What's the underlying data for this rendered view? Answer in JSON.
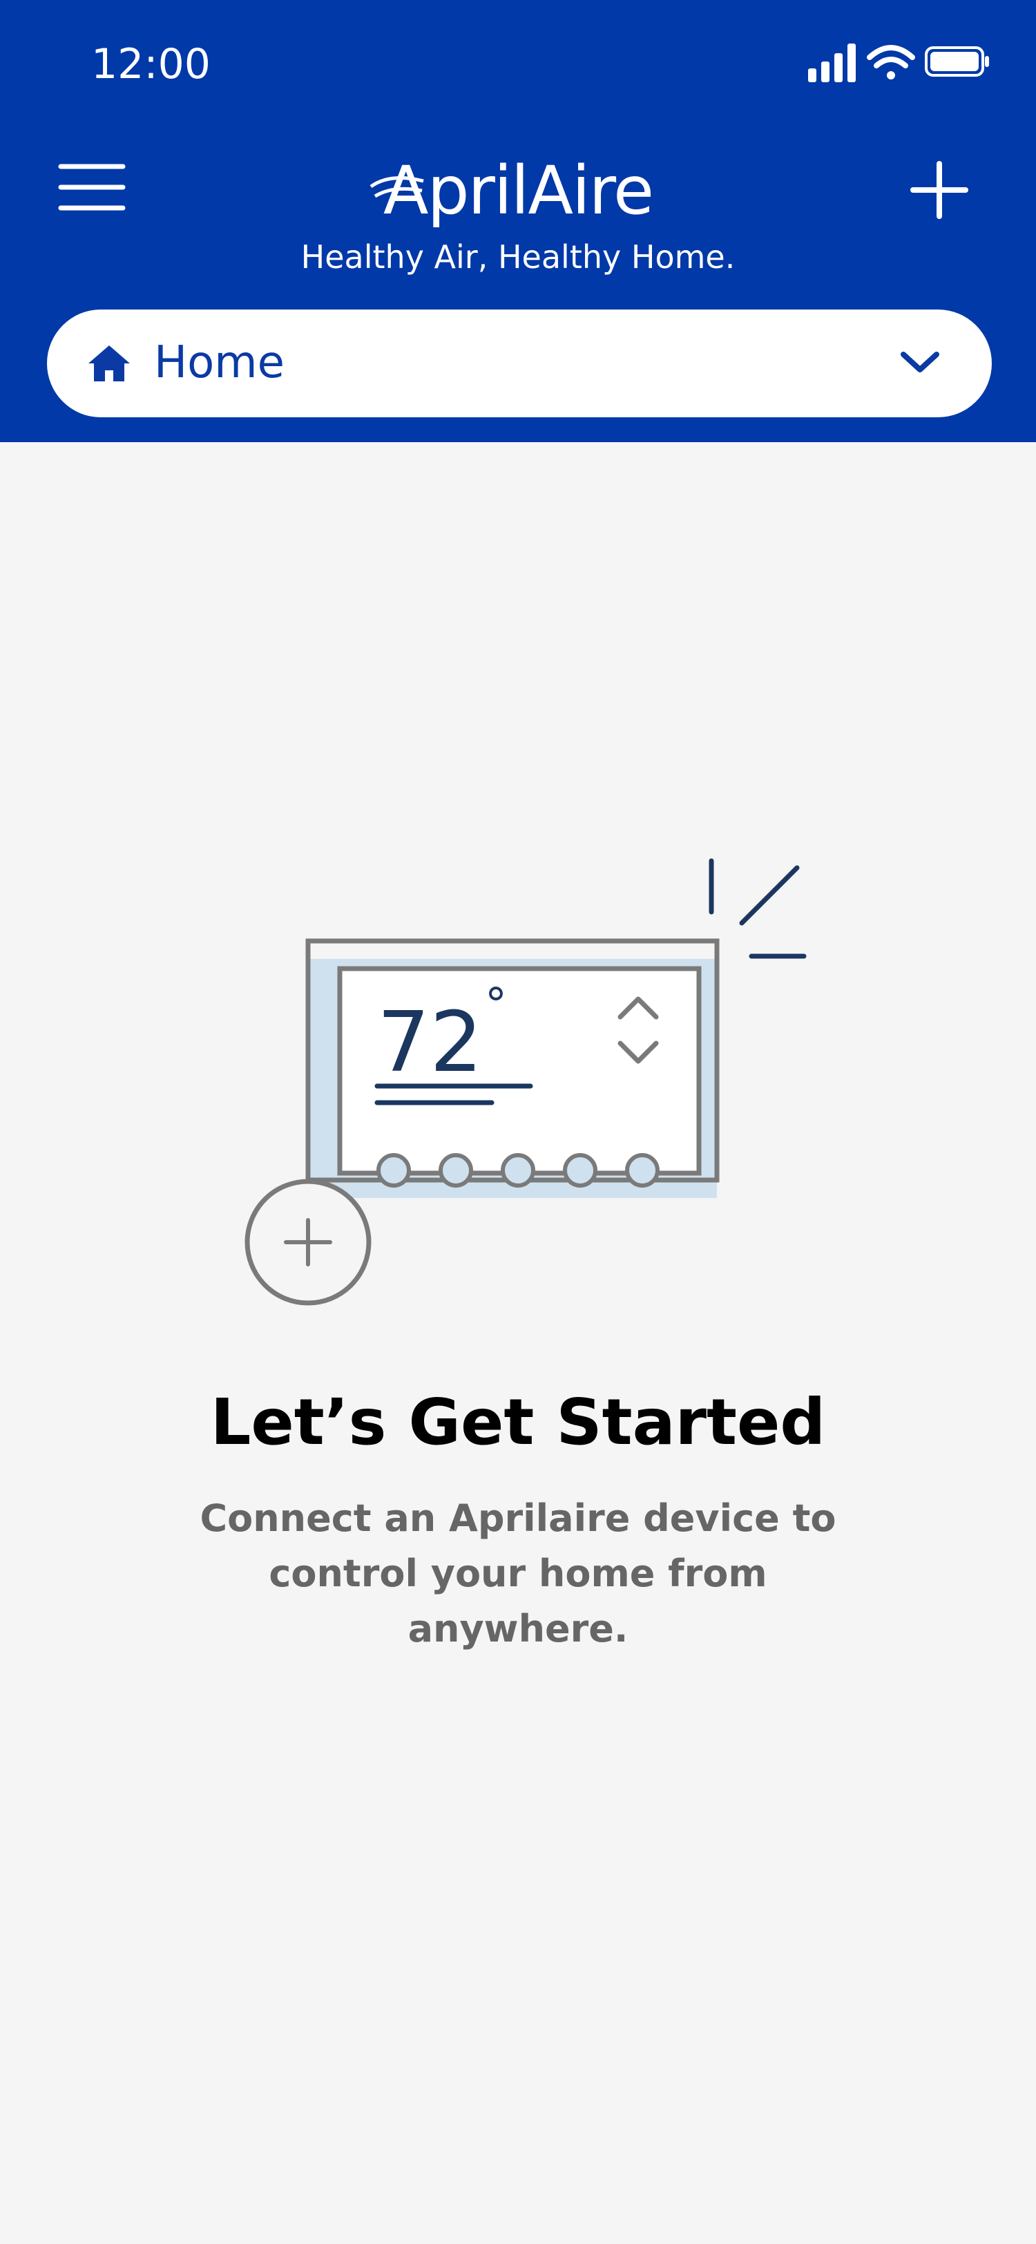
{
  "status_bar": {
    "time": "12:00"
  },
  "header": {
    "brand": "AprilAire",
    "tagline": "Healthy Air, Healthy Home.",
    "menu_icon": "hamburger-menu-icon",
    "add_icon": "plus-icon"
  },
  "home_selector": {
    "label": "Home",
    "icon": "house-icon",
    "chevron": "chevron-down-icon"
  },
  "illustration": {
    "temperature": "72",
    "degree_symbol": "°"
  },
  "empty_state": {
    "title": "Let’s Get Started",
    "message": "Connect an Aprilaire device to control your home from anywhere."
  },
  "colors": {
    "brand_blue": "#0239a8",
    "background": "#f5f5f5",
    "illustration_navy": "#1b3760"
  }
}
